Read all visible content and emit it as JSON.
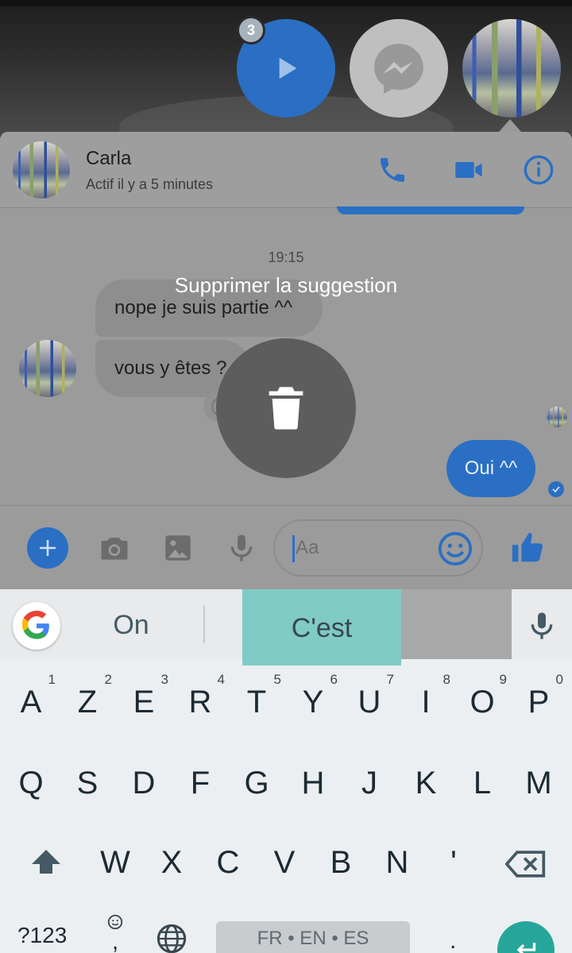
{
  "chat_heads": {
    "play_badge_count": "3",
    "icons": [
      "play-icon",
      "messenger-icon",
      "avatar"
    ]
  },
  "header": {
    "name": "Carla",
    "status": "Actif il y a 5 minutes",
    "icons": [
      "phone-icon",
      "video-icon",
      "info-icon"
    ]
  },
  "conversation": {
    "timestamp": "19:15",
    "incoming": [
      "nope je suis partie ^^",
      "vous y êtes ?"
    ],
    "outgoing": [
      "Oui ^^"
    ]
  },
  "composer": {
    "placeholder": "Aa",
    "icons": [
      "plus-icon",
      "camera-icon",
      "image-icon",
      "mic-icon",
      "emoji-icon",
      "thumbs-up-icon"
    ]
  },
  "overlay": {
    "label": "Supprimer la suggestion",
    "icon": "trash-icon"
  },
  "keyboard": {
    "suggestions": [
      "On",
      "C'est"
    ],
    "row1": [
      {
        "k": "A",
        "h": "1"
      },
      {
        "k": "Z",
        "h": "2"
      },
      {
        "k": "E",
        "h": "3"
      },
      {
        "k": "R",
        "h": "4"
      },
      {
        "k": "T",
        "h": "5"
      },
      {
        "k": "Y",
        "h": "6"
      },
      {
        "k": "U",
        "h": "7"
      },
      {
        "k": "I",
        "h": "8"
      },
      {
        "k": "O",
        "h": "9"
      },
      {
        "k": "P",
        "h": "0"
      }
    ],
    "row2": [
      "Q",
      "S",
      "D",
      "F",
      "G",
      "H",
      "J",
      "K",
      "L",
      "M"
    ],
    "row3": [
      "W",
      "X",
      "C",
      "V",
      "B",
      "N",
      "'"
    ],
    "symbols_key": "?123",
    "comma_key": ",",
    "space_label": "FR • EN • ES",
    "period_key": ".",
    "accent_color": "#26a69a",
    "messenger_blue": "#2a6fc3"
  }
}
